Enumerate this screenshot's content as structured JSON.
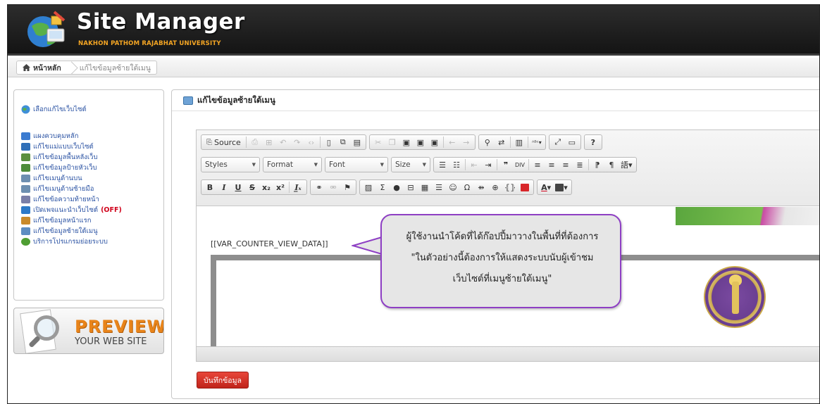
{
  "header": {
    "title": "Site Manager",
    "subtitle": "NAKHON PATHOM RAJABHAT UNIVERSITY"
  },
  "breadcrumb": {
    "home": "หน้าหลัก",
    "current": "แก้ไขข้อมูลซ้ายใต้เมนู"
  },
  "sidebar": {
    "select_site": "เลือกแก้ไขเว็บไซต์",
    "items": [
      {
        "label": "แผงควบคุมหลัก",
        "icon": "dashboard-icon",
        "color": "#3b7bd0"
      },
      {
        "label": "แก้ไขแม่แบบเว็บไซต์",
        "icon": "template-icon",
        "color": "#2f6fb8"
      },
      {
        "label": "แก้ไขข้อมูลพื้นหลังเว็บ",
        "icon": "background-icon",
        "color": "#5b8f3e"
      },
      {
        "label": "แก้ไขข้อมูลป้ายหัวเว็บ",
        "icon": "banner-icon",
        "color": "#4e8c3a"
      },
      {
        "label": "แก้ไขเมนูด้านบน",
        "icon": "top-menu-icon",
        "color": "#6d8fb0"
      },
      {
        "label": "แก้ไขเมนูด้านซ้ายมือ",
        "icon": "left-menu-icon",
        "color": "#6d8fb0"
      },
      {
        "label": "แก้ไขข้อความท้ายหน้า",
        "icon": "footer-icon",
        "color": "#7a7fa8"
      },
      {
        "label": "เปิดเพจแนะนำเว็บไซต์",
        "icon": "intro-page-icon",
        "color": "#2d79c7",
        "badge": "(OFF)"
      },
      {
        "label": "แก้ไขข้อมูลหน้าแรก",
        "icon": "home-icon",
        "color": "#c98a2b"
      },
      {
        "label": "แก้ไขข้อมูลซ้ายใต้เมนู",
        "icon": "left-under-menu-icon",
        "color": "#5d8dc2"
      },
      {
        "label": "บริการโปรแกรมย่อยระบบ",
        "icon": "services-icon",
        "color": "#4f9e33"
      }
    ],
    "preview": {
      "title": "PREVIEW",
      "subtitle": "YOUR WEB SITE"
    }
  },
  "panel": {
    "title": "แก้ไขข้อมูลซ้ายใต้เมนู"
  },
  "editor": {
    "source_label": "Source",
    "styles_label": "Styles",
    "format_label": "Format",
    "font_label": "Font",
    "size_label": "Size",
    "content_text": "[[VAR_COUNTER_VIEW_DATA]]"
  },
  "callout": {
    "line1": "ผู้ใช้งานนำโค้ดที่ได้ก๊อปปี้มาวางในพื้นที่ที่ต้องการ",
    "line2": "\"ในตัวอย่างนี้ต้องการให้แสดงระบบนับผู้เข้าชม",
    "line3": "เว็บไซต์ที่เมนูซ้ายใต้เมนู\""
  },
  "actions": {
    "save_label": "บันทึกข้อมูล"
  },
  "colors": {
    "accent_purple": "#8e3fc4",
    "save_red": "#d3362b",
    "preview_orange": "#e8841a",
    "link_blue": "#2a52a3"
  }
}
